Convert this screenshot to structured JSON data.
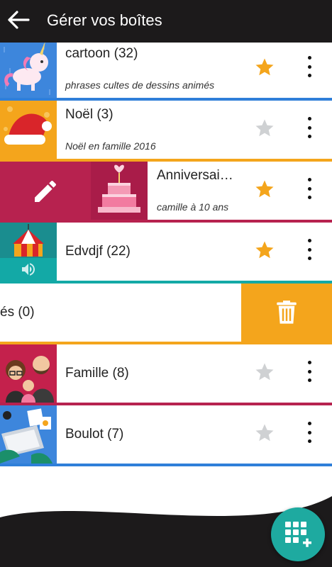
{
  "header": {
    "title": "Gérer vos boîtes"
  },
  "colors": {
    "blue": "#2f7fd9",
    "orange": "#f4a51c",
    "crimson": "#b7224f",
    "teal": "#13a9a6",
    "star_on": "#f4a51c",
    "star_off": "#cfd1d3",
    "fab": "#1eaaa0"
  },
  "boxes": [
    {
      "name": "cartoon  (32)",
      "subtitle": "phrases cultes de dessins animés",
      "favorite": true,
      "icon": "unicorn-icon"
    },
    {
      "name": "Noël  (3)",
      "subtitle": "Noël en famille 2016",
      "favorite": false,
      "icon": "santa-hat-icon"
    },
    {
      "name": "Anniversai…",
      "subtitle": "camille à 10 ans",
      "favorite": true,
      "icon": "birthday-cake-icon",
      "swipe_action": "edit-icon"
    },
    {
      "name": "Edvdjf  (22)",
      "subtitle": "",
      "favorite": true,
      "icon": "circus-tent-icon",
      "extra_icon": "speaker-icon"
    },
    {
      "name": "és  (0)",
      "subtitle": "",
      "swipe_action": "trash-icon"
    },
    {
      "name": "Famille (8)",
      "subtitle": "",
      "favorite": false,
      "icon": "family-icon"
    },
    {
      "name": "Boulot (7)",
      "subtitle": "",
      "favorite": false,
      "icon": "laptop-icon"
    }
  ]
}
